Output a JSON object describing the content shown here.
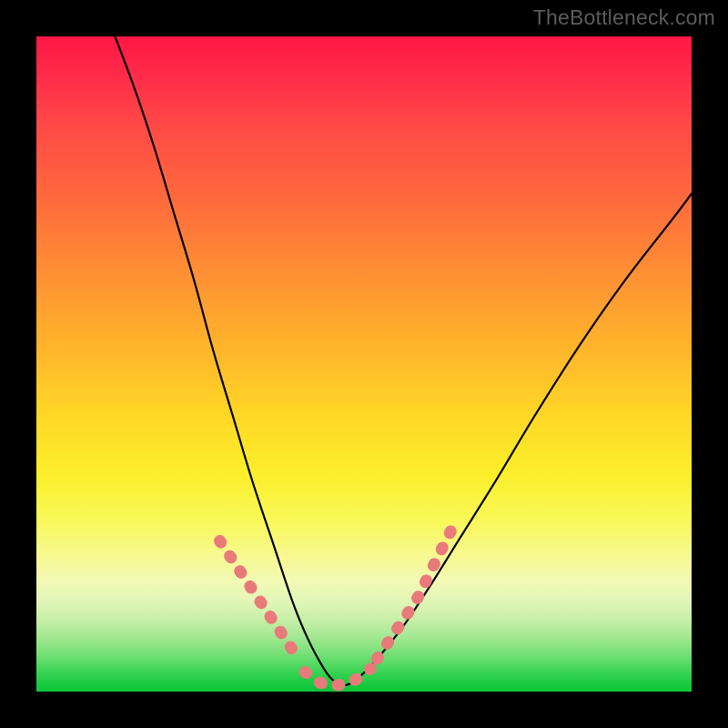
{
  "watermark": "TheBottleneck.com",
  "chart_data": {
    "type": "line",
    "title": "",
    "xlabel": "",
    "ylabel": "",
    "x_range": [
      0,
      100
    ],
    "y_range": [
      0,
      100
    ],
    "grid": false,
    "series": [
      {
        "name": "bottleneck-curve",
        "description": "V-shaped curve; steep descent from top-left, minimum near x≈45 at bottom, gentler ascent toward upper-right",
        "x": [
          12,
          15,
          18,
          21,
          24,
          27,
          30,
          33,
          36,
          39,
          41,
          43,
          45,
          47,
          49,
          52,
          56,
          60,
          65,
          70,
          76,
          83,
          90,
          97,
          100
        ],
        "y": [
          100,
          92,
          83,
          73,
          63,
          52,
          42,
          32,
          23,
          14,
          9,
          5,
          2,
          1,
          2,
          5,
          10,
          16,
          24,
          32,
          42,
          53,
          63,
          72,
          76
        ]
      }
    ],
    "overlays": [
      {
        "name": "lower-highlight-dots",
        "description": "Thicker salmon dotted highlight tracing the lower part of the V (both legs near the trough)",
        "color": "#e97a7a",
        "segments": [
          {
            "x": [
              28,
              30,
              32,
              34,
              36,
              38,
              40
            ],
            "y": [
              23,
              20,
              17,
              14,
              11,
              8,
              5
            ]
          },
          {
            "x": [
              41,
              43,
              45,
              47,
              49,
              51
            ],
            "y": [
              3,
              1.5,
              1,
              1.2,
              2,
              3.5
            ]
          },
          {
            "x": [
              52,
              54,
              56,
              58,
              60,
              62,
              64
            ],
            "y": [
              5,
              8,
              11,
              14,
              18,
              22,
              26
            ]
          }
        ]
      }
    ],
    "gradient_stops": [
      {
        "pos": 0,
        "label": "red"
      },
      {
        "pos": 0.5,
        "label": "yellow"
      },
      {
        "pos": 1.0,
        "label": "green"
      }
    ]
  }
}
